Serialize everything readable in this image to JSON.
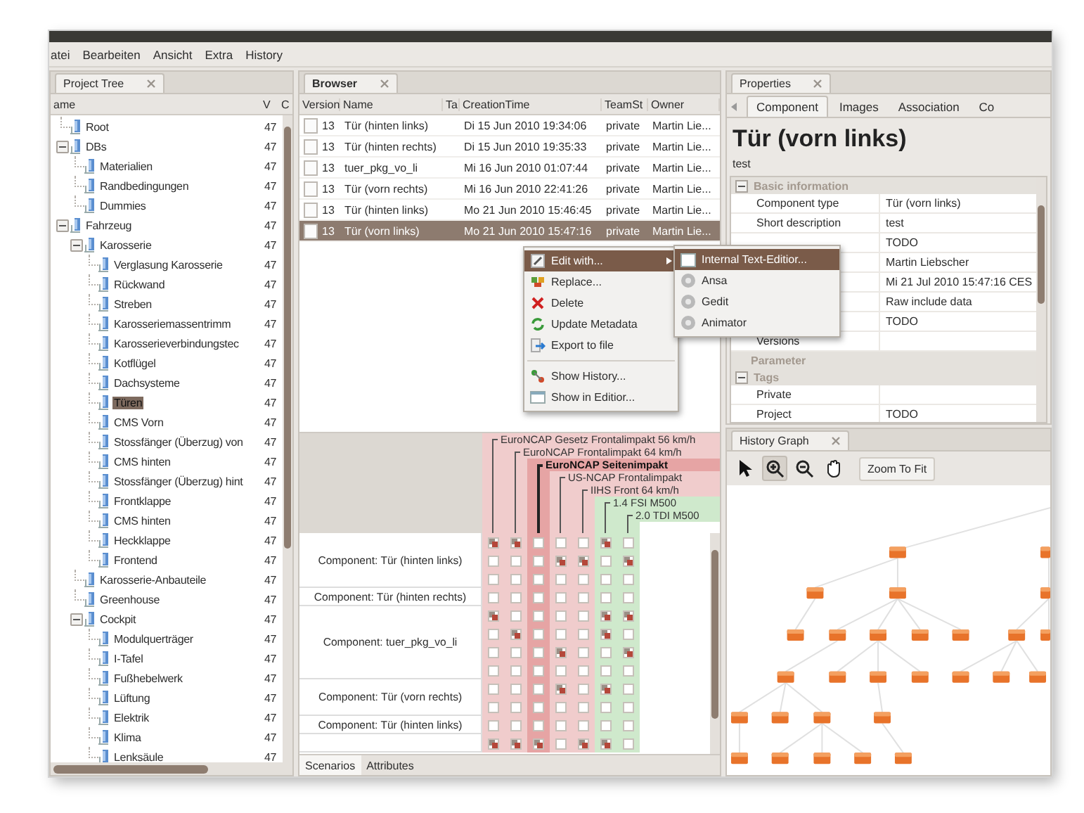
{
  "window": {
    "menu": [
      "atei",
      "Bearbeiten",
      "Ansicht",
      "Extra",
      "History"
    ]
  },
  "project_tree": {
    "title": "Project Tree",
    "active": false,
    "columns": [
      "ame",
      "V",
      "C"
    ],
    "items": [
      {
        "label": "Root",
        "v": "47",
        "selected": false
      },
      {
        "label": "DBs",
        "v": "47",
        "selected": false,
        "expanded": true,
        "children": [
          {
            "label": "Materialien",
            "v": "47",
            "selected": false
          },
          {
            "label": "Randbedingungen",
            "v": "47",
            "selected": false
          },
          {
            "label": "Dummies",
            "v": "47",
            "selected": false
          }
        ]
      },
      {
        "label": "Fahrzeug",
        "v": "47",
        "selected": false,
        "expanded": true,
        "children": [
          {
            "label": "Karosserie",
            "v": "47",
            "selected": false,
            "expanded": true,
            "children": [
              {
                "label": "Verglasung Karosserie",
                "v": "47",
                "selected": false
              },
              {
                "label": "Rückwand",
                "v": "47",
                "selected": false
              },
              {
                "label": "Streben",
                "v": "47",
                "selected": false
              },
              {
                "label": "Karosseriemassentrimm",
                "v": "47",
                "selected": false
              },
              {
                "label": "Karosserieverbindungstec",
                "v": "47",
                "selected": false
              },
              {
                "label": "Kotflügel",
                "v": "47",
                "selected": false
              },
              {
                "label": "Dachsysteme",
                "v": "47",
                "selected": false
              },
              {
                "label": "Türen",
                "v": "47",
                "selected": true
              },
              {
                "label": "CMS Vorn",
                "v": "47",
                "selected": false
              },
              {
                "label": "Stossfänger (Überzug) von",
                "v": "47",
                "selected": false
              },
              {
                "label": "CMS hinten",
                "v": "47",
                "selected": false
              },
              {
                "label": "Stossfänger (Überzug) hint",
                "v": "47",
                "selected": false
              },
              {
                "label": "Frontklappe",
                "v": "47",
                "selected": false
              },
              {
                "label": "CMS hinten",
                "v": "47",
                "selected": false
              },
              {
                "label": "Heckklappe",
                "v": "47",
                "selected": false
              },
              {
                "label": "Frontend",
                "v": "47",
                "selected": false
              }
            ]
          },
          {
            "label": "Karosserie-Anbauteile",
            "v": "47",
            "selected": false
          },
          {
            "label": "Greenhouse",
            "v": "47",
            "selected": false
          },
          {
            "label": "Cockpit",
            "v": "47",
            "selected": false,
            "expanded": true,
            "children": [
              {
                "label": "Modulquerträger",
                "v": "47",
                "selected": false
              },
              {
                "label": "I-Tafel",
                "v": "47",
                "selected": false
              },
              {
                "label": "Fußhebelwerk",
                "v": "47",
                "selected": false
              },
              {
                "label": "Lüftung",
                "v": "47",
                "selected": false
              },
              {
                "label": "Elektrik",
                "v": "47",
                "selected": false
              },
              {
                "label": "Klima",
                "v": "47",
                "selected": false
              },
              {
                "label": "Lenksäule",
                "v": "47",
                "selected": false
              }
            ]
          }
        ]
      }
    ]
  },
  "browser": {
    "title": "Browser",
    "active": true,
    "columns": [
      "Version",
      "Name",
      "Ta",
      "CreationTime",
      "TeamSt",
      "Owner"
    ],
    "rows": [
      {
        "version": "13",
        "name": "Tür (hinten links)",
        "created": "Di 15 Jun 2010 19:34:06",
        "team": "private",
        "owner": "Martin Lie...",
        "selected": false
      },
      {
        "version": "13",
        "name": "Tür (hinten rechts)",
        "created": "Di 15 Jun 2010 19:35:33",
        "team": "private",
        "owner": "Martin Lie...",
        "selected": false
      },
      {
        "version": "13",
        "name": "tuer_pkg_vo_li",
        "created": "Mi 16 Jun 2010 01:07:44",
        "team": "private",
        "owner": "Martin Lie...",
        "selected": false
      },
      {
        "version": "13",
        "name": "Tür (vorn rechts)",
        "created": "Mi 16 Jun 2010 22:41:26",
        "team": "private",
        "owner": "Martin Lie...",
        "selected": false
      },
      {
        "version": "13",
        "name": "Tür (hinten links)",
        "created": "Mo 21 Jun 2010 15:46:45",
        "team": "private",
        "owner": "Martin Lie...",
        "selected": false
      },
      {
        "version": "13",
        "name": "Tür (vorn links)",
        "created": "Mo 21 Jun 2010 15:47:16",
        "team": "private",
        "owner": "Martin Lie...",
        "selected": true
      }
    ]
  },
  "matrix": {
    "scenarios": [
      {
        "label": "EuroNCAP Gesetz Frontalimpakt 56 km/h",
        "color": "#f0cccc",
        "selected": false
      },
      {
        "label": "EuroNCAP Frontalimpakt 64 km/h",
        "color": "#f0cccc",
        "selected": false
      },
      {
        "label": "EuroNCAP Seitenimpakt",
        "color": "#e6a4a4",
        "selected": true
      },
      {
        "label": "US-NCAP Frontalimpakt",
        "color": "#f0cccc",
        "selected": false
      },
      {
        "label": "IIHS Front 64 km/h",
        "color": "#f0cccc",
        "selected": false
      },
      {
        "label": "1.4 FSI M500",
        "color": "#cfe9cc",
        "selected": false
      },
      {
        "label": "2.0 TDI M500",
        "color": "#cfe9cc",
        "selected": false
      }
    ],
    "groups": [
      {
        "label": "Component: Tür (hinten links)",
        "rows": [
          {
            "checked": [
              true,
              true,
              false,
              false,
              false,
              true,
              false
            ]
          },
          {
            "checked": [
              false,
              false,
              false,
              true,
              true,
              false,
              true
            ]
          },
          {
            "checked": [
              false,
              false,
              false,
              false,
              false,
              false,
              false
            ]
          }
        ]
      },
      {
        "label": "Component: Tür (hinten rechts)",
        "rows": [
          {
            "checked": [
              false,
              false,
              false,
              false,
              false,
              false,
              false
            ]
          }
        ]
      },
      {
        "label": "Component: tuer_pkg_vo_li",
        "rows": [
          {
            "checked": [
              true,
              false,
              false,
              false,
              false,
              true,
              true
            ]
          },
          {
            "checked": [
              false,
              true,
              false,
              false,
              false,
              true,
              false
            ]
          },
          {
            "checked": [
              false,
              false,
              false,
              true,
              false,
              false,
              true
            ]
          },
          {
            "checked": [
              false,
              false,
              false,
              false,
              false,
              false,
              false
            ]
          }
        ]
      },
      {
        "label": "Component: Tür (vorn rechts)",
        "rows": [
          {
            "checked": [
              false,
              false,
              false,
              true,
              false,
              true,
              false
            ]
          },
          {
            "checked": [
              false,
              false,
              false,
              false,
              false,
              false,
              false
            ]
          }
        ]
      },
      {
        "label": "Component: Tür (hinten links)",
        "rows": [
          {
            "checked": [
              false,
              false,
              false,
              false,
              false,
              false,
              false
            ]
          }
        ]
      },
      {
        "rows": [
          {
            "checked": [
              true,
              true,
              true,
              false,
              true,
              true,
              false
            ]
          }
        ]
      }
    ],
    "tabs": [
      {
        "label": "Scenarios",
        "selected": true
      },
      {
        "label": "Attributes",
        "selected": false
      }
    ]
  },
  "context_menu": {
    "items": [
      {
        "kind": "submenu",
        "label": "Edit with...",
        "highlighted": true
      },
      {
        "kind": "item",
        "label": "Replace...",
        "highlighted": false
      },
      {
        "kind": "item",
        "label": "Delete",
        "highlighted": false
      },
      {
        "kind": "item",
        "label": "Update Metadata",
        "highlighted": false
      },
      {
        "kind": "item",
        "label": "Export to file",
        "highlighted": false
      },
      {
        "kind": "separator"
      },
      {
        "kind": "item",
        "label": "Show History...",
        "highlighted": false
      },
      {
        "kind": "item",
        "label": "Show in Editior...",
        "highlighted": false
      }
    ]
  },
  "submenu": {
    "items": [
      {
        "label": "Internal Text-Editior...",
        "highlighted": true
      },
      {
        "label": "Ansa",
        "highlighted": false
      },
      {
        "label": "Gedit",
        "highlighted": false
      },
      {
        "label": "Animator",
        "highlighted": false
      }
    ]
  },
  "properties": {
    "title": "Properties",
    "active": false,
    "tabs": [
      {
        "label": "Component",
        "selected": true
      },
      {
        "label": "Images",
        "selected": false
      },
      {
        "label": "Association",
        "selected": false
      },
      {
        "label": "Co",
        "selected": false
      }
    ],
    "heading": "Tür (vorn links)",
    "description": "test",
    "sections": [
      {
        "label": "Basic information",
        "expanded": true,
        "rows": [
          {
            "name": "Component type",
            "value": "Tür (vorn links)"
          },
          {
            "name": "Short description",
            "value": "test"
          },
          {
            "value": "TODO"
          },
          {
            "value": "Martin Liebscher"
          },
          {
            "value": "Mi 21 Jul 2010 15:47:16 CES"
          },
          {
            "value": "Raw include data"
          },
          {
            "value": "TODO"
          },
          {
            "name": "Versions"
          }
        ]
      },
      {
        "label": "Parameter"
      },
      {
        "label": "Tags",
        "expanded": true,
        "rows": [
          {
            "name": "Private"
          },
          {
            "name": "Project",
            "value": "TODO"
          }
        ]
      }
    ]
  },
  "history": {
    "title": "History Graph",
    "active": false,
    "tools": [
      {
        "kind": "pointer",
        "selected": false
      },
      {
        "kind": "zoom-in",
        "selected": true
      },
      {
        "kind": "zoom-out",
        "selected": false
      },
      {
        "kind": "pan",
        "selected": false
      }
    ],
    "zoom_button": "Zoom To Fit"
  }
}
